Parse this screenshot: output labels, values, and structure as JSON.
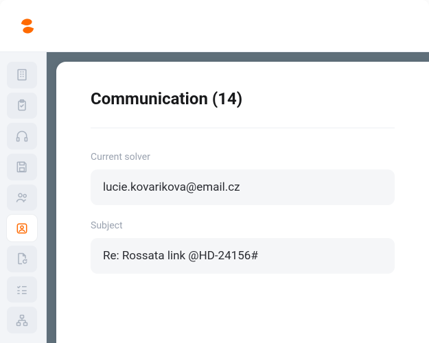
{
  "header": {
    "title_parts": {
      "name": "Communication",
      "count": 14
    },
    "title": "Communication (14)"
  },
  "sidebar": {
    "items": [
      {
        "name": "building-icon",
        "active": false
      },
      {
        "name": "clipboard-icon",
        "active": false
      },
      {
        "name": "headset-icon",
        "active": false
      },
      {
        "name": "disk-icon",
        "active": false
      },
      {
        "name": "users-icon",
        "active": false
      },
      {
        "name": "contact-icon",
        "active": true
      },
      {
        "name": "refresh-doc-icon",
        "active": false
      },
      {
        "name": "checklist-icon",
        "active": false
      },
      {
        "name": "sitemap-icon",
        "active": false
      }
    ]
  },
  "form": {
    "solver": {
      "label": "Current solver",
      "value": "lucie.kovarikova@email.cz"
    },
    "subject": {
      "label": "Subject",
      "value": "Re: Rossata link @HD-24156#"
    }
  },
  "brand": {
    "logo": "S",
    "color": "#ff6a00"
  }
}
